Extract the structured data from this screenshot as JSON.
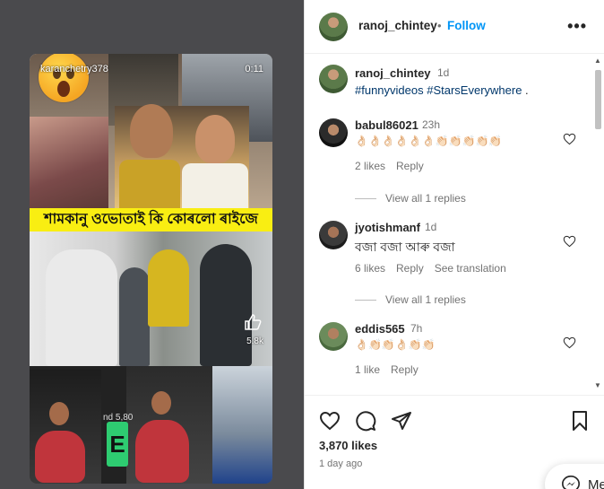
{
  "post": {
    "reel": {
      "watermark_user": "karanchetry378",
      "timer": "0:11",
      "caption": "শামকানু ওভোতাই কি কোৰলো ৰাইজে",
      "likes_overlay": "5.8k",
      "green_letter": "E",
      "faded_text": "nd 5,80"
    },
    "header": {
      "username": "ranoj_chintey",
      "separator": "•",
      "follow_label": "Follow",
      "more_label": "•••"
    },
    "caption": {
      "username": "ranoj_chintey",
      "time": "1d",
      "text": "#funnyvideos #StarsEverywhere",
      "trailing": " ."
    },
    "comments": [
      {
        "username": "babul86021",
        "time": "23h",
        "text": "👌🏻👌🏻👌🏻👌🏻👌🏻👌🏻👏🏻👏🏻👏🏻👏🏻👏🏻",
        "likes": "2 likes",
        "reply": "Reply",
        "view_replies": "View all 1 replies"
      },
      {
        "username": "jyotishmanf",
        "time": "1d",
        "text": "বজা বজা আৰু বজা",
        "likes": "6 likes",
        "reply": "Reply",
        "translation": "See translation",
        "view_replies": "View all 1 replies"
      },
      {
        "username": "eddis565",
        "time": "7h",
        "text": "👌🏻👏🏻👏🏻👌🏻👏🏻👏🏻",
        "likes": "1 like",
        "reply": "Reply"
      }
    ],
    "likes_count": "3,870 likes",
    "posted_ago": "1 day ago",
    "messages_label": "Me"
  },
  "colors": {
    "link": "#0095f6",
    "hashtag": "#00376b",
    "text": "#262626",
    "muted": "#737373",
    "caption_bg": "#f9ee12",
    "media_bg": "#4a4a4d"
  },
  "icons": [
    "heart-icon",
    "comment-icon",
    "share-icon",
    "bookmark-icon",
    "more-icon",
    "messenger-icon",
    "thumbs-up-icon",
    "surprised-emoji-icon"
  ]
}
